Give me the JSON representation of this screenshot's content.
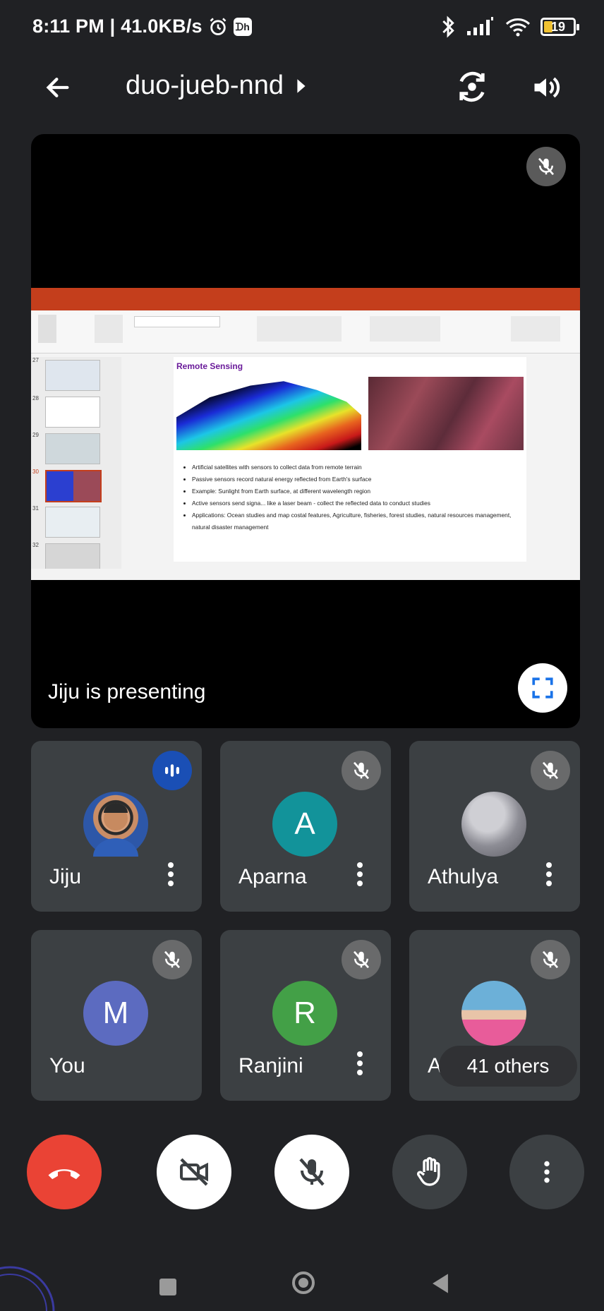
{
  "status_bar": {
    "time_speed": "8:11 PM | 41.0KB/s",
    "battery": "19",
    "colors": {
      "battery_fill": "#f1c232"
    }
  },
  "meeting": {
    "code": "duo-jueb-nnd",
    "icons": [
      "back-arrow-icon",
      "chevron-right-icon",
      "switch-camera-icon",
      "speaker-icon"
    ]
  },
  "presentation": {
    "label": "Jiju is presenting",
    "slide": {
      "title": "Remote Sensing",
      "bullets": [
        "Artificial satellites with sensors to collect data from remote terrain",
        "Passive sensors record natural energy reflected from Earth's surface",
        "Example: Sunlight from Earth surface, at different wavelength region",
        "Active sensors send signa... like a laser beam - collect the reflected data to conduct studies",
        "Applications: Ocean studies and map costal features, Agriculture, fisheries, forest studies, natural resources management, natural disaster management"
      ],
      "thumbnail_numbers": [
        "27",
        "28",
        "29",
        "30",
        "31",
        "32"
      ]
    }
  },
  "participants": [
    {
      "name": "Jiju",
      "avatar_type": "photo",
      "state": "speaking"
    },
    {
      "name": "Aparna",
      "initial": "A",
      "avatar_color": "#12939a",
      "state": "muted"
    },
    {
      "name": "Athulya",
      "avatar_type": "photo",
      "state": "muted"
    },
    {
      "name": "You",
      "initial": "M",
      "avatar_color": "#5c6bc0",
      "state": "muted"
    },
    {
      "name": "Ranjini",
      "initial": "R",
      "avatar_color": "#43a047",
      "state": "muted"
    },
    {
      "name": "Adithya",
      "name_visible": "A",
      "avatar_type": "photo",
      "state": "muted",
      "overlay": "41 others"
    }
  ],
  "controls": {
    "colors": {
      "end_call": "#ea4335",
      "active": "#ffffff",
      "inactive": "#3c4043"
    },
    "icons": [
      "end-call-icon",
      "camera-off-icon",
      "mic-off-icon",
      "raise-hand-icon",
      "more-options-icon"
    ]
  }
}
